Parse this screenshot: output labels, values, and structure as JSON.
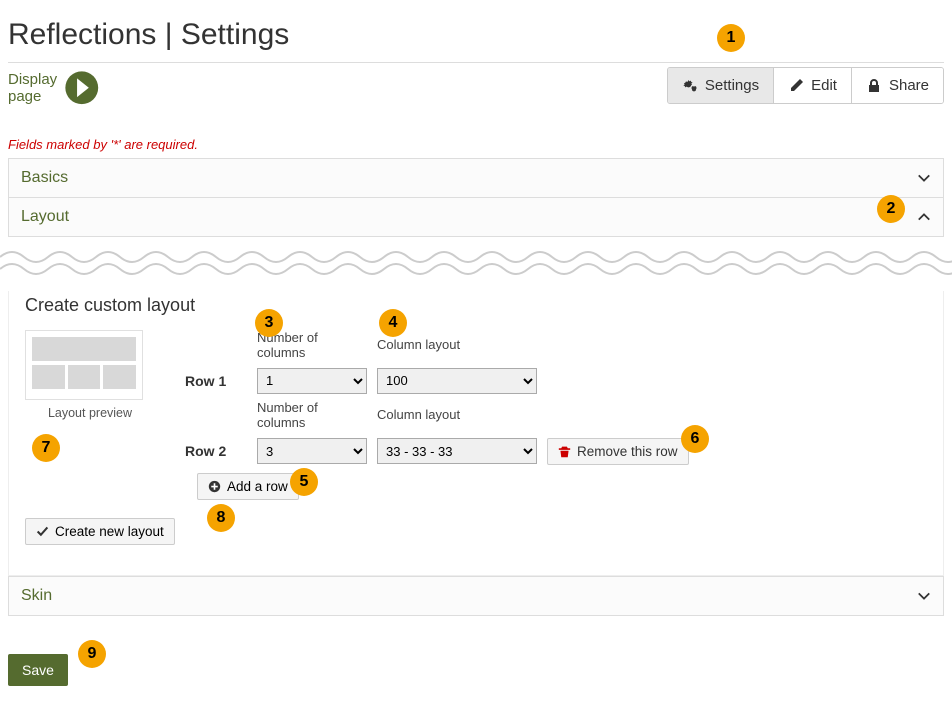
{
  "page_title": "Reflections | Settings",
  "display_page_label": "Display page",
  "tabs": {
    "settings": "Settings",
    "edit": "Edit",
    "share": "Share"
  },
  "required_note": "Fields marked by '*' are required.",
  "sections": {
    "basics": "Basics",
    "layout": "Layout",
    "skin": "Skin"
  },
  "custom_layout": {
    "title": "Create custom layout",
    "preview_label": "Layout preview",
    "col_header_num": "Number of columns",
    "col_header_layout": "Column layout",
    "rows": [
      {
        "label": "Row 1",
        "num_columns": "1",
        "column_layout": "100"
      },
      {
        "label": "Row 2",
        "num_columns": "3",
        "column_layout": "33 - 33 - 33"
      }
    ],
    "remove_row_label": "Remove this row",
    "add_row_label": "Add a row",
    "create_new_label": "Create new layout"
  },
  "save_label": "Save",
  "markers": [
    "1",
    "2",
    "3",
    "4",
    "5",
    "6",
    "7",
    "8",
    "9"
  ]
}
